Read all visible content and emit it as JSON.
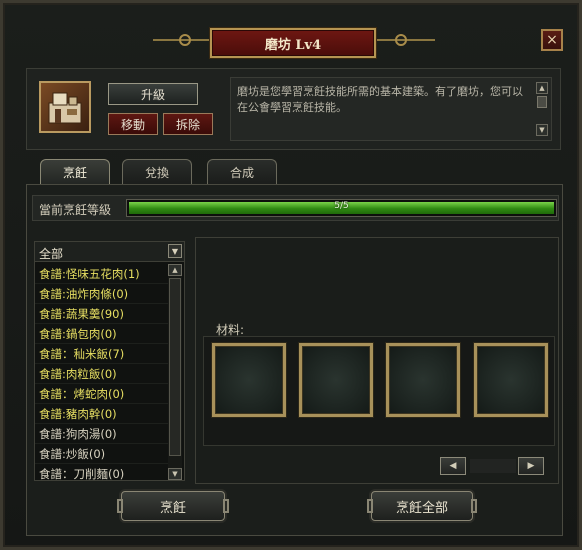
{
  "window": {
    "title": "磨坊 Lv4",
    "close_icon": "×"
  },
  "building": {
    "upgrade_label": "升級",
    "move_label": "移動",
    "demolish_label": "拆除",
    "description": "磨坊是您學習烹飪技能所需的基本建築。有了磨坊，您可以在公會學習烹飪技能。"
  },
  "tabs": [
    {
      "label": "烹飪",
      "active": true
    },
    {
      "label": "兌換",
      "active": false
    },
    {
      "label": "合成",
      "active": false
    }
  ],
  "level": {
    "label": "當前烹飪等級",
    "progress_text": "5/5",
    "progress": 1.0
  },
  "recipe_list": {
    "filter_label": "全部",
    "items": [
      {
        "label": "食譜:怪味五花肉(1)",
        "color": "#e7df62"
      },
      {
        "label": "食譜:油炸肉條(0)",
        "color": "#e7df62"
      },
      {
        "label": "食譜:蔬果羹(90)",
        "color": "#e7df62"
      },
      {
        "label": "食譜:鍋包肉(0)",
        "color": "#e7df62"
      },
      {
        "label": "食譜：秈米飯(7)",
        "color": "#e7df62"
      },
      {
        "label": "食譜:肉粒飯(0)",
        "color": "#e7df62"
      },
      {
        "label": "食譜：烤蛇肉(0)",
        "color": "#e7df62"
      },
      {
        "label": "食譜:豬肉幹(0)",
        "color": "#e7df62"
      },
      {
        "label": "食譜:狗肉湯(0)",
        "color": "#d8d3c0"
      },
      {
        "label": "食譜:炒飯(0)",
        "color": "#d8d3c0"
      },
      {
        "label": "食譜：刀削麵(0)",
        "color": "#d8d3c0"
      }
    ]
  },
  "materials": {
    "label": "材料:",
    "slot_count": 4
  },
  "actions": {
    "cook_label": "烹飪",
    "cook_all_label": "烹飪全部"
  }
}
